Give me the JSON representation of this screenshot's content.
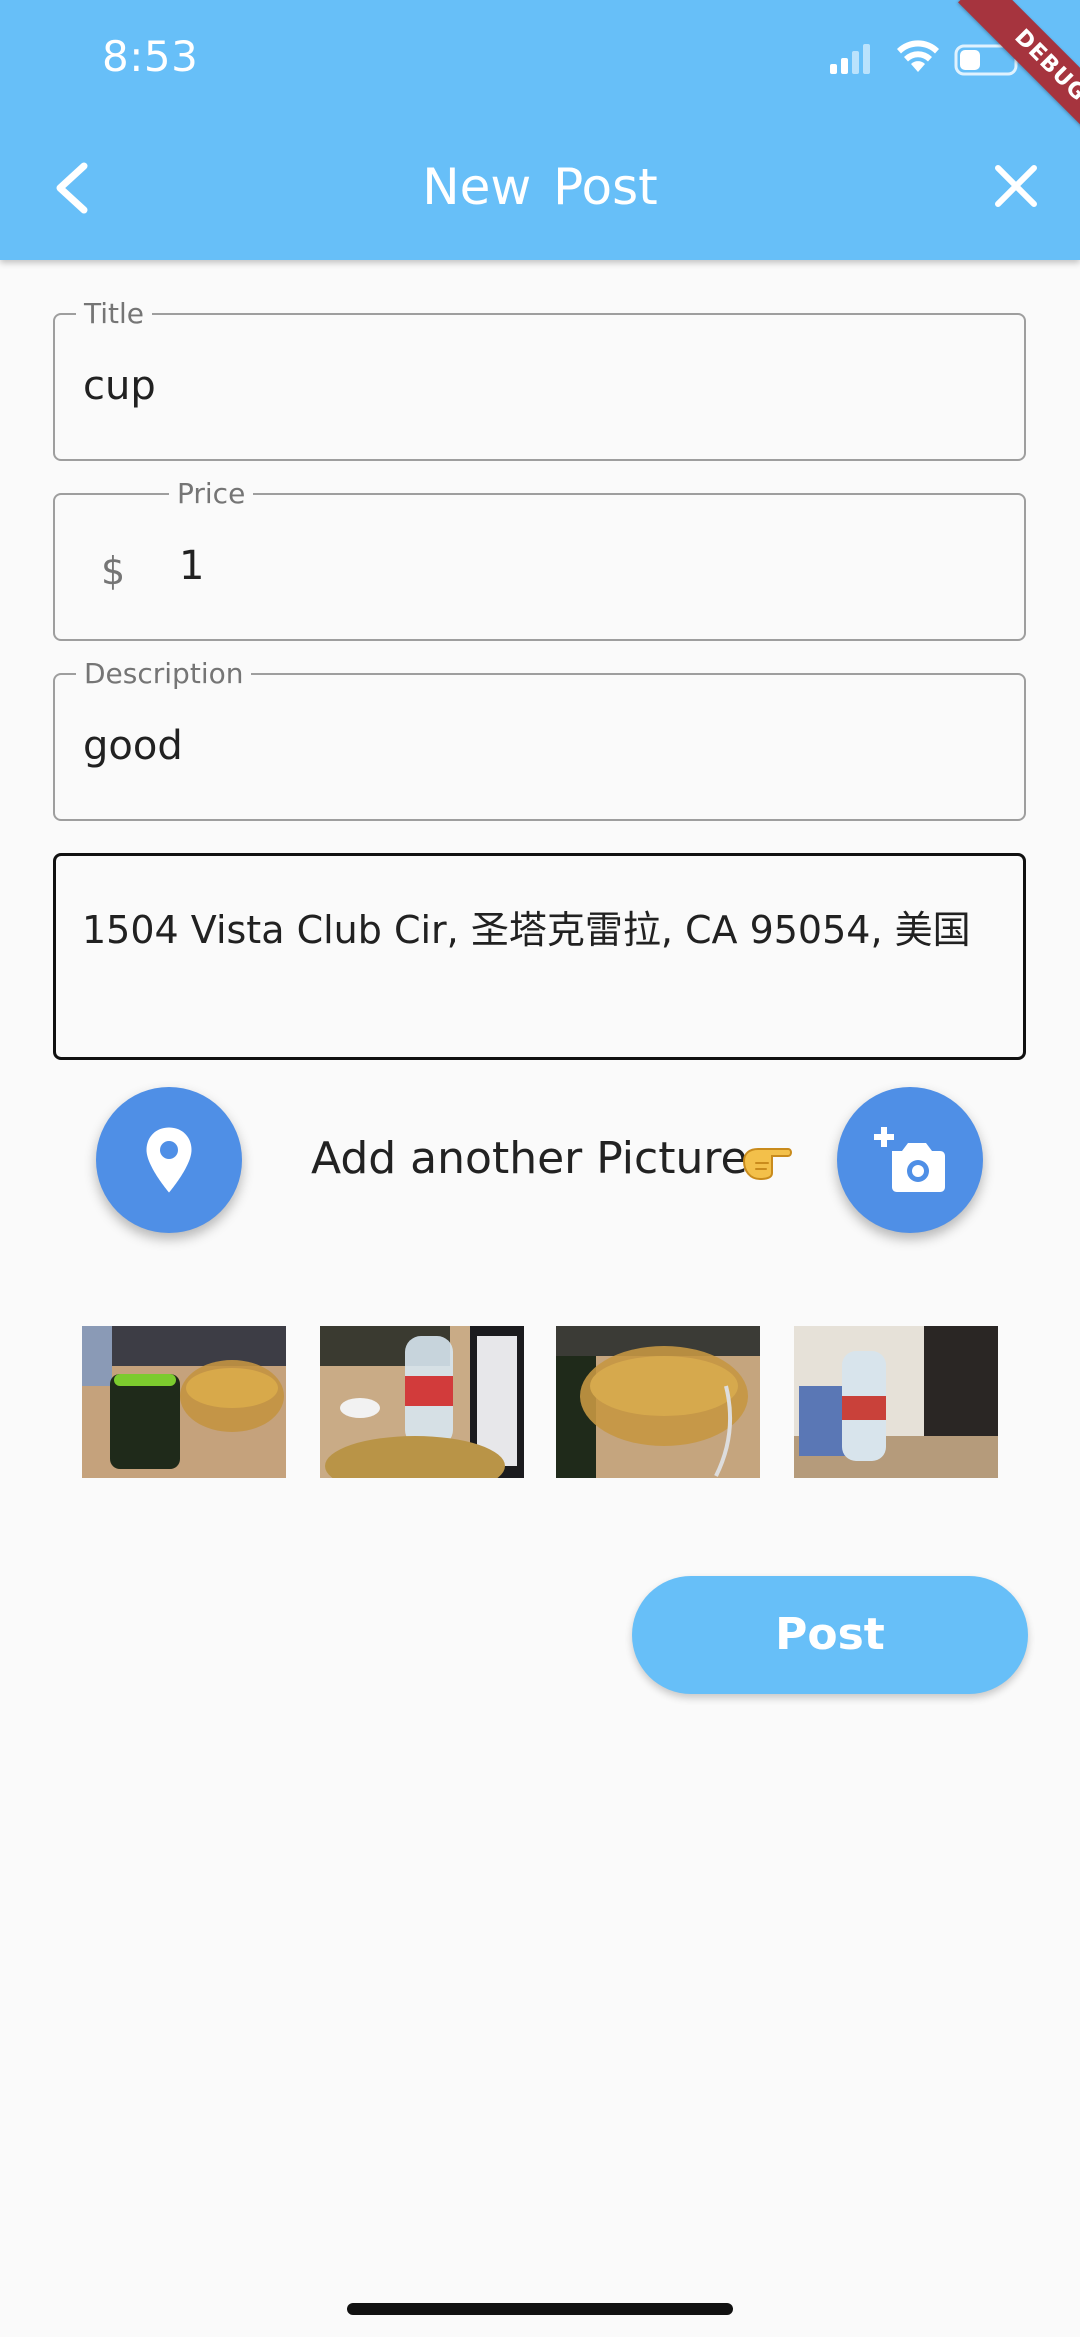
{
  "status_bar": {
    "time": "8:53"
  },
  "debug_banner": "DEBUG",
  "appbar": {
    "title": "New  Post"
  },
  "form": {
    "title": {
      "label": "Title",
      "value": "cup"
    },
    "price": {
      "label": "Price",
      "prefix": "$",
      "value": "1"
    },
    "description": {
      "label": "Description",
      "value": "good"
    },
    "address": {
      "value": "1504 Vista Club Cir, 圣塔克雷拉, CA  95054, 美国"
    }
  },
  "actions": {
    "add_picture_label": "Add another Picture",
    "location_icon": "location-pin-icon",
    "camera_icon": "add-a-photo-icon",
    "post_label": "Post"
  },
  "thumbnails": [
    {
      "name": "thumbnail-mug-bowl"
    },
    {
      "name": "thumbnail-water-bottle"
    },
    {
      "name": "thumbnail-bowl-closeup"
    },
    {
      "name": "thumbnail-bottles-chair"
    }
  ],
  "colors": {
    "appbar": "#67bff8",
    "fab": "#4f8fe6",
    "post_button": "#67bff8",
    "debug_banner": "#a6343e"
  }
}
